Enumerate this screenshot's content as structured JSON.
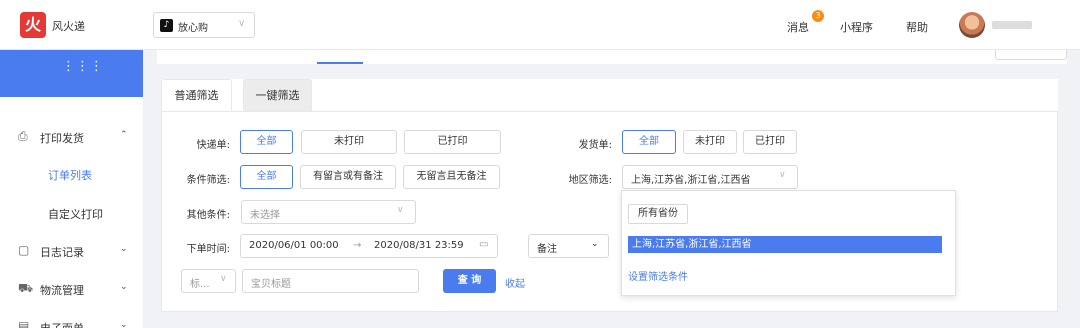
{
  "header": {
    "logo_char": "火",
    "brand": "风火递",
    "shop_icon": "♪",
    "shop_name": "放心购",
    "shop_caret": "∨",
    "messages": "消息",
    "message_badge": "3",
    "miniprogram": "小程序",
    "help": "帮助"
  },
  "sidebar": {
    "grid_icon": "⋮⋮⋮",
    "items": [
      {
        "icon": "⎙",
        "label": "打印发货",
        "arrow": "⌃"
      },
      {
        "label": "订单列表"
      },
      {
        "label": "自定义打印"
      },
      {
        "icon": "▢",
        "label": "日志记录",
        "arrow": "⌄"
      },
      {
        "icon": "⛟",
        "label": "物流管理",
        "arrow": "⌄"
      },
      {
        "icon": "▤",
        "label": "电子面单",
        "arrow": "⌄"
      }
    ]
  },
  "tabs": {
    "normal": "普通筛选",
    "oneclick": "一键筛选"
  },
  "filters": {
    "express_label": "快递单:",
    "express_opts": [
      "全部",
      "未打印",
      "已打印"
    ],
    "ship_label": "发货单:",
    "ship_opts": [
      "全部",
      "未打印",
      "已打印"
    ],
    "cond_label": "条件筛选:",
    "cond_opts": [
      "全部",
      "有留言或有备注",
      "无留言且无备注"
    ],
    "region_label": "地区筛选:",
    "region_value": "上海,江苏省,浙江省,江西省",
    "other_label": "其他条件:",
    "other_placeholder": "未选择",
    "time_label": "下单时间:",
    "time_start": "2020/06/01 00:00",
    "time_arrow": "→",
    "time_end": "2020/08/31 23:59",
    "calendar_icon": "▭",
    "remark_select": "备注",
    "title_select": "标...",
    "title_placeholder": "宝贝标题",
    "query_button": "查 询",
    "collapse_link": "收起",
    "caret": "∨",
    "caret_bold": "⌄"
  },
  "region_dropdown": {
    "all_provinces": "所有省份",
    "selected": "上海,江苏省,浙江省,江西省",
    "set_condition": "设置筛选条件"
  }
}
